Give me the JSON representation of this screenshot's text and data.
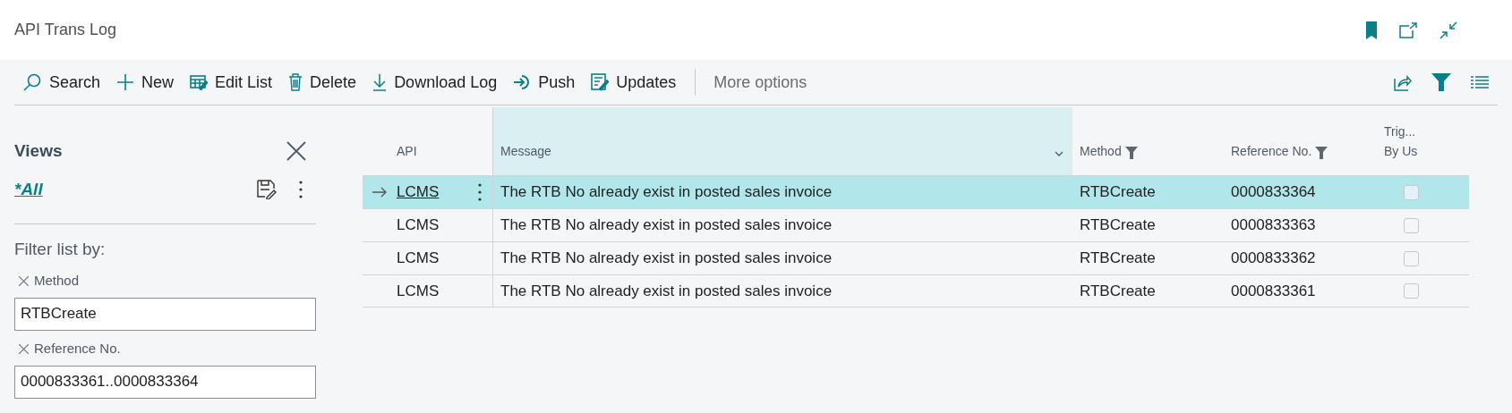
{
  "window": {
    "title": "API Trans Log"
  },
  "toolbar": {
    "actions": [
      {
        "kind": "search",
        "label": "Search"
      },
      {
        "kind": "new",
        "label": "New"
      },
      {
        "kind": "edit_list",
        "label": "Edit List"
      },
      {
        "kind": "delete",
        "label": "Delete"
      },
      {
        "kind": "download",
        "label": "Download Log"
      },
      {
        "kind": "push",
        "label": "Push"
      },
      {
        "kind": "updates",
        "label": "Updates"
      }
    ],
    "more": "More options"
  },
  "views": {
    "title": "Views",
    "current_view": "*All"
  },
  "filter": {
    "heading": "Filter list by:",
    "fields": [
      {
        "label": "Method",
        "value": "RTBCreate"
      },
      {
        "label": "Reference No.",
        "value": "0000833361..0000833364"
      }
    ]
  },
  "table": {
    "columns": [
      {
        "label": "API",
        "filtered": false,
        "selected": false
      },
      {
        "label": "Message",
        "filtered": false,
        "selected": true
      },
      {
        "label": "Method",
        "filtered": true,
        "selected": false
      },
      {
        "label": "Reference No.",
        "filtered": true,
        "selected": false
      },
      {
        "lines": [
          "Trig...",
          "By Us"
        ],
        "filtered": false,
        "selected": false
      }
    ],
    "rows": [
      {
        "api": "LCMS",
        "message": "The RTB No already exist in posted sales invoice",
        "method": "RTBCreate",
        "reference_no": "0000833364",
        "triggered_by_user": false,
        "selected": true
      },
      {
        "api": "LCMS",
        "message": "The RTB No already exist in posted sales invoice",
        "method": "RTBCreate",
        "reference_no": "0000833363",
        "triggered_by_user": false,
        "selected": false
      },
      {
        "api": "LCMS",
        "message": "The RTB No already exist in posted sales invoice",
        "method": "RTBCreate",
        "reference_no": "0000833362",
        "triggered_by_user": false,
        "selected": false
      },
      {
        "api": "LCMS",
        "message": "The RTB No already exist in posted sales invoice",
        "method": "RTBCreate",
        "reference_no": "0000833361",
        "triggered_by_user": false,
        "selected": false
      }
    ]
  }
}
